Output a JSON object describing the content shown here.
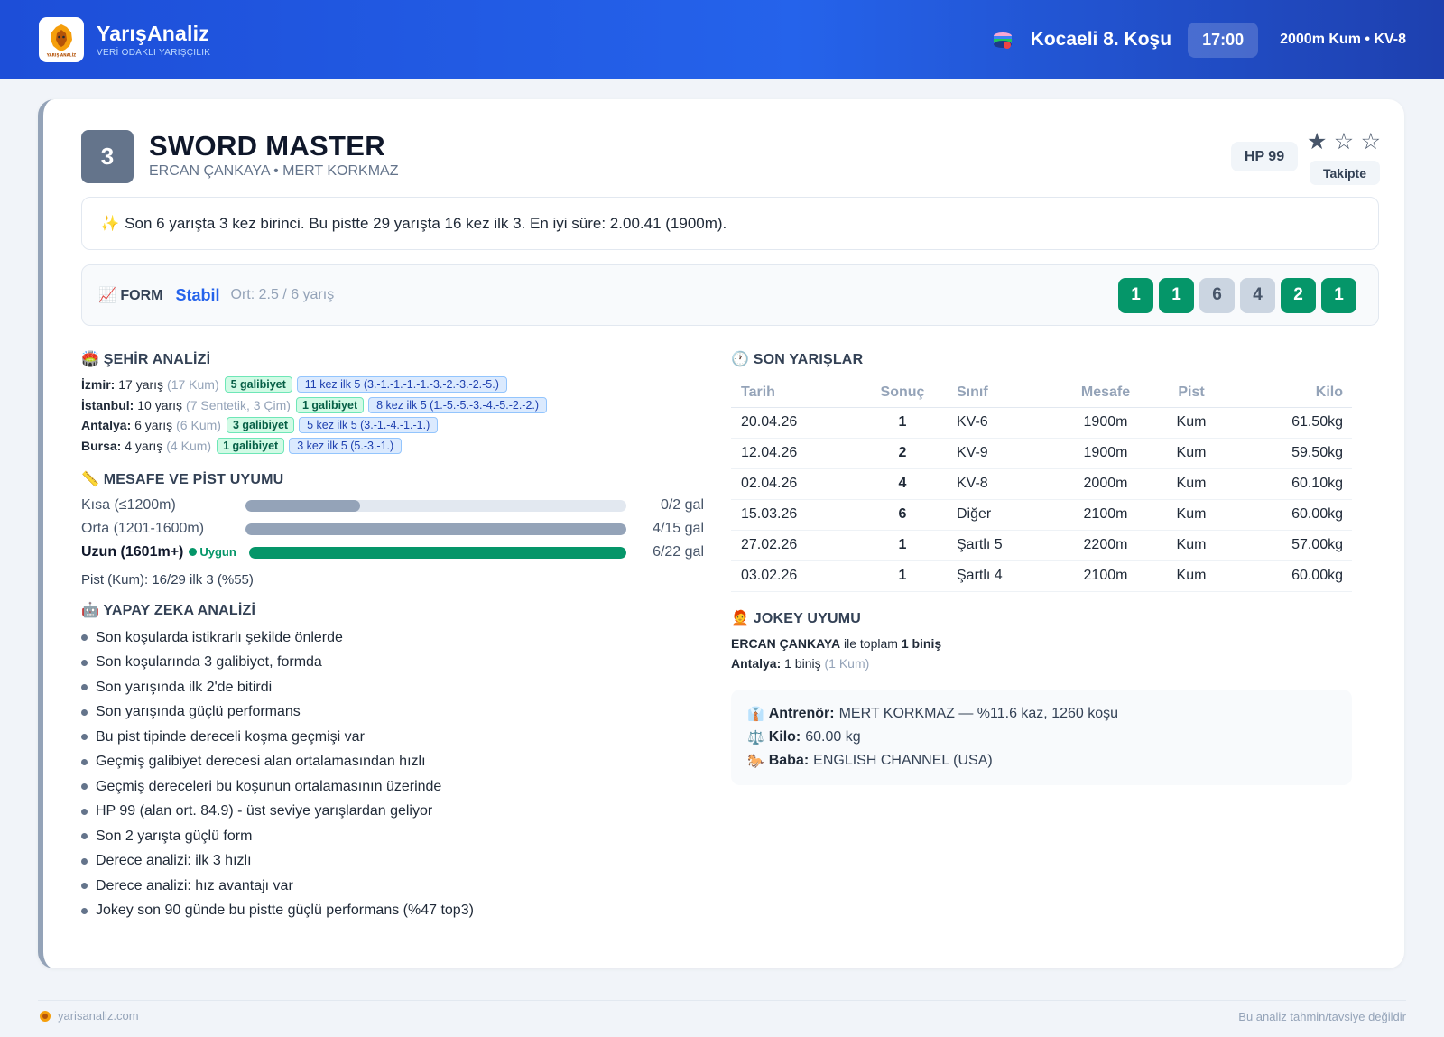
{
  "brand": {
    "name": "YarışAnaliz",
    "tagline": "VERİ ODAKLI YARIŞÇILIK",
    "logo_text": "YARIŞ ANALİZ"
  },
  "race": {
    "title": "Kocaeli 8. Koşu",
    "time": "17:00",
    "meta": "2000m Kum • KV-8"
  },
  "horse": {
    "number": "3",
    "name": "SWORD MASTER",
    "subtitle": "ERCAN ÇANKAYA • MERT KORKMAZ",
    "hp": "HP 99",
    "rating_stars": 1,
    "rating_max": 5,
    "stars": [
      "★",
      "☆",
      "☆"
    ],
    "follow_label": "Takipte"
  },
  "summary": {
    "icon": "✨",
    "text": "Son 6 yarışta 3 kez birinci. Bu pistte 29 yarışta 16 kez ilk 3. En iyi süre: 2.00.41 (1900m)."
  },
  "form": {
    "icon": "📈",
    "label": "FORM",
    "state": "Stabil",
    "avg": "Ort: 2.5 / 6 yarış",
    "results": [
      "1",
      "1",
      "6",
      "4",
      "2",
      "1"
    ]
  },
  "city": {
    "icon": "🏟️",
    "title": "ŞEHİR ANALİZİ",
    "rows": [
      {
        "city": "İzmir:",
        "races": "17 yarış",
        "detail": "(17 Kum)",
        "wins": "5 galibiyet",
        "top5": "11 kez ilk 5 (3.-1.-1.-1.-1.-3.-2.-3.-2.-5.)"
      },
      {
        "city": "İstanbul:",
        "races": "10 yarış",
        "detail": "(7 Sentetik, 3 Çim)",
        "wins": "1 galibiyet",
        "top5": "8 kez ilk 5 (1.-5.-5.-3.-4.-5.-2.-2.)"
      },
      {
        "city": "Antalya:",
        "races": "6 yarış",
        "detail": "(6 Kum)",
        "wins": "3 galibiyet",
        "top5": "5 kez ilk 5 (3.-1.-4.-1.-1.)"
      },
      {
        "city": "Bursa:",
        "races": "4 yarış",
        "detail": "(4 Kum)",
        "wins": "1 galibiyet",
        "top5": "3 kez ilk 5 (5.-3.-1.)"
      }
    ]
  },
  "distance": {
    "icon": "📏",
    "title": "MESAFE VE PİST UYUMU",
    "rows": [
      {
        "label": "Kısa (≤1200m)",
        "value": "0/2 gal",
        "fill_pct": 30,
        "highlight": false,
        "tag": ""
      },
      {
        "label": "Orta (1201-1600m)",
        "value": "4/15 gal",
        "fill_pct": 100,
        "highlight": false,
        "tag": ""
      },
      {
        "label": "Uzun (1601m+)",
        "value": "6/22 gal",
        "fill_pct": 100,
        "highlight": true,
        "tag": "Uygun"
      }
    ],
    "pist_note": "Pist (Kum): 16/29 ilk 3 (%55)"
  },
  "ai": {
    "icon": "🤖",
    "title": "YAPAY ZEKA ANALİZİ",
    "items": [
      "Son koşularda istikrarlı şekilde önlerde",
      "Son koşularında 3 galibiyet, formda",
      "Son yarışında ilk 2'de bitirdi",
      "Son yarışında güçlü performans",
      "Bu pist tipinde dereceli koşma geçmişi var",
      "Geçmiş galibiyet derecesi alan ortalamasından hızlı",
      "Geçmiş dereceleri bu koşunun ortalamasının üzerinde",
      "HP 99 (alan ort. 84.9) - üst seviye yarışlardan geliyor",
      "Son 2 yarışta güçlü form",
      "Derece analizi: ilk 3 hızlı",
      "Derece analizi: hız avantajı var",
      "Jokey son 90 günde bu pistte güçlü performans (%47 top3)"
    ]
  },
  "recent": {
    "icon": "🕐",
    "title": "SON YARIŞLAR",
    "headers": [
      "Tarih",
      "Sonuç",
      "Sınıf",
      "Mesafe",
      "Pist",
      "Kilo"
    ],
    "rows": [
      [
        "20.04.26",
        "1",
        "KV-6",
        "1900m",
        "Kum",
        "61.50kg"
      ],
      [
        "12.04.26",
        "2",
        "KV-9",
        "1900m",
        "Kum",
        "59.50kg"
      ],
      [
        "02.04.26",
        "4",
        "KV-8",
        "2000m",
        "Kum",
        "60.10kg"
      ],
      [
        "15.03.26",
        "6",
        "Diğer",
        "2100m",
        "Kum",
        "60.00kg"
      ],
      [
        "27.02.26",
        "1",
        "Şartlı 5",
        "2200m",
        "Kum",
        "57.00kg"
      ],
      [
        "03.02.26",
        "1",
        "Şartlı 4",
        "2100m",
        "Kum",
        "60.00kg"
      ]
    ]
  },
  "jockey": {
    "icon": "🧑‍🦰",
    "title": "JOKEY UYUMU",
    "name": "ERCAN ÇANKAYA",
    "with_text": "ile toplam",
    "total": "1 biniş",
    "city_label": "Antalya:",
    "city_value": "1 biniş",
    "city_detail": "(1 Kum)"
  },
  "extra": [
    {
      "icon": "👔",
      "label": "Antrenör:",
      "value": "MERT KORKMAZ — %11.6 kaz, 1260 koşu"
    },
    {
      "icon": "⚖️",
      "label": "Kilo:",
      "value": "60.00 kg"
    },
    {
      "icon": "🐎",
      "label": "Baba:",
      "value": "ENGLISH CHANNEL (USA)"
    }
  ],
  "footer": {
    "site": "yarisanaliz.com",
    "disclaimer": "Bu analiz tahmin/tavsiye değildir"
  },
  "colors": {
    "header": "#2563eb",
    "win": "#059669",
    "place": "#d97706",
    "accent": "#2563eb"
  }
}
